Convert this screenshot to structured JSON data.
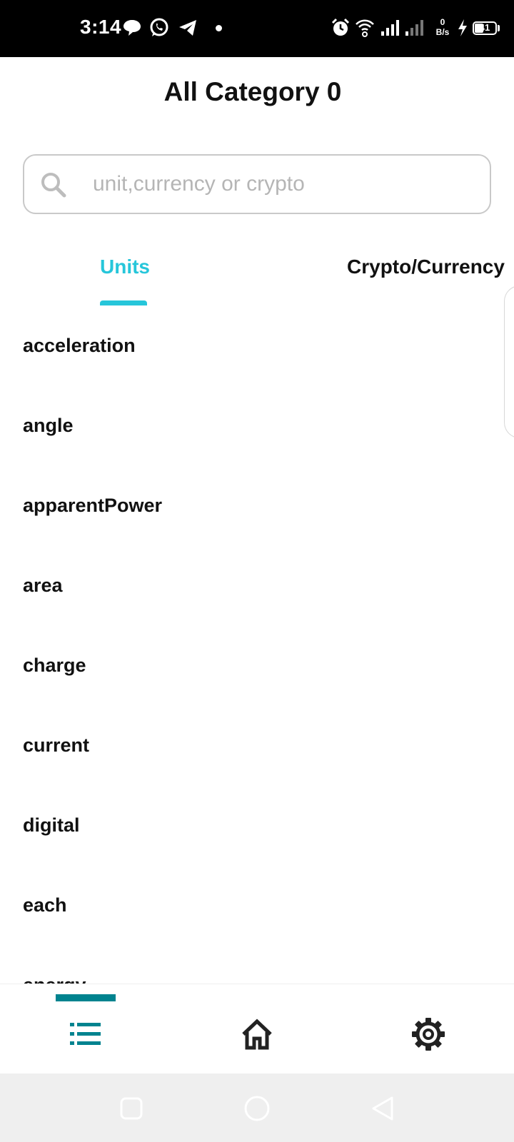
{
  "status_bar": {
    "time": "3:14",
    "net_speed_value": "0",
    "net_speed_unit": "B/s",
    "battery_level": "41",
    "icons": [
      "chat-bubble-icon",
      "whatsapp-icon",
      "telegram-icon",
      "notification-dot-icon",
      "alarm-icon",
      "wifi-icon",
      "signal-icon",
      "signal-weak-icon",
      "charging-icon",
      "battery-icon"
    ]
  },
  "header": {
    "title": "All Category 0"
  },
  "search": {
    "placeholder": "unit,currency or crypto",
    "value": "",
    "icon": "search-icon"
  },
  "tabs": {
    "items": [
      {
        "label": "Units",
        "active": true
      },
      {
        "label": "Crypto/Currency",
        "active": false
      }
    ]
  },
  "categories": {
    "items": [
      "acceleration",
      "angle",
      "apparentPower",
      "area",
      "charge",
      "current",
      "digital",
      "each",
      "energy"
    ]
  },
  "bottom_nav": {
    "items": [
      {
        "icon": "list-icon",
        "active": true
      },
      {
        "icon": "home-icon",
        "active": false
      },
      {
        "icon": "gear-icon",
        "active": false
      }
    ]
  },
  "system_nav": {
    "items": [
      "recents-square-icon",
      "home-circle-icon",
      "back-triangle-icon"
    ]
  },
  "colors": {
    "accent": "#26c6da",
    "nav_active": "#00838f",
    "text": "#111111",
    "placeholder": "#b5b5b5"
  }
}
